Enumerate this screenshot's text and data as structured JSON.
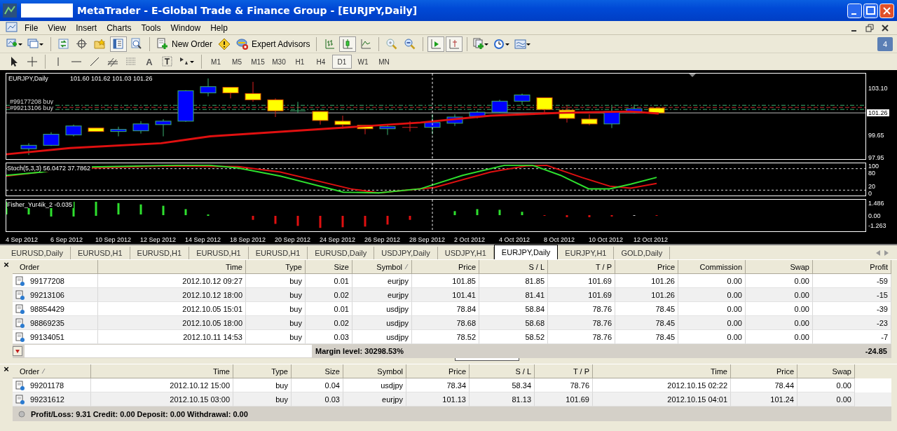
{
  "window": {
    "title": "MetaTrader - E-Global Trade & Finance Group - [EURJPY,Daily]"
  },
  "menu": [
    "File",
    "View",
    "Insert",
    "Charts",
    "Tools",
    "Window",
    "Help"
  ],
  "toolbar": {
    "data_window_on": true,
    "new_order": "New Order",
    "expert_advisors": "Expert Advisors",
    "chart_modes": [
      {
        "selected": false
      },
      {
        "selected": true
      },
      {
        "selected": false
      }
    ],
    "auto_scroll_on": true,
    "chart_shift_on": true,
    "notifications": "4"
  },
  "drawing_toolbar": {
    "text_tool": "A",
    "timeframes": [
      {
        "label": "M1",
        "selected": false
      },
      {
        "label": "M5",
        "selected": false
      },
      {
        "label": "M15",
        "selected": false
      },
      {
        "label": "M30",
        "selected": false
      },
      {
        "label": "H1",
        "selected": false
      },
      {
        "label": "H4",
        "selected": false
      },
      {
        "label": "D1",
        "selected": true
      },
      {
        "label": "W1",
        "selected": false
      },
      {
        "label": "MN",
        "selected": false
      }
    ]
  },
  "chart": {
    "symbol": "EURJPY,Daily",
    "ohlc": "101.60 101.62 101.03 101.26",
    "order_lines": [
      "#99177208 buy",
      "#99213106 buy"
    ],
    "price_axis": [
      "103.10",
      "99.65",
      "97.95"
    ],
    "current_price": "101.26",
    "stochastic": {
      "label": "Stoch(5,3,3) 56.0472 37.7862",
      "axis": [
        "100",
        "80",
        "20",
        "0"
      ]
    },
    "fisher": {
      "label": "Fisher_Yur4ik_2 -0.035",
      "axis": [
        "1.486",
        "0.00",
        "-1.263"
      ]
    },
    "dates": [
      "4 Sep 2012",
      "6 Sep 2012",
      "10 Sep 2012",
      "12 Sep 2012",
      "14 Sep 2012",
      "18 Sep 2012",
      "20 Sep 2012",
      "24 Sep 2012",
      "26 Sep 2012",
      "28 Sep 2012",
      "2 Oct 2012",
      "4 Oct 2012",
      "8 Oct 2012",
      "10 Oct 2012",
      "12 Oct 2012"
    ]
  },
  "chart_tabs": [
    {
      "label": "EURUSD,Daily",
      "selected": false
    },
    {
      "label": "EURUSD,H1",
      "selected": false
    },
    {
      "label": "EURUSD,H1",
      "selected": false
    },
    {
      "label": "EURUSD,H1",
      "selected": false
    },
    {
      "label": "EURUSD,H1",
      "selected": false
    },
    {
      "label": "EURUSD,Daily",
      "selected": false
    },
    {
      "label": "USDJPY,Daily",
      "selected": false
    },
    {
      "label": "USDJPY,H1",
      "selected": false
    },
    {
      "label": "EURJPY,Daily",
      "selected": true
    },
    {
      "label": "EURJPY,H1",
      "selected": false
    },
    {
      "label": "GOLD,Daily",
      "selected": false
    }
  ],
  "trade": {
    "close": "×",
    "columns": [
      {
        "label": "Order",
        "sorted": false
      },
      {
        "label": "Time",
        "sorted": false
      },
      {
        "label": "Type",
        "sorted": false
      },
      {
        "label": "Size",
        "sorted": false
      },
      {
        "label": "Symbol",
        "sorted": true
      },
      {
        "label": "Price",
        "sorted": false
      },
      {
        "label": "S / L",
        "sorted": false
      },
      {
        "label": "T / P",
        "sorted": false
      },
      {
        "label": "Price",
        "sorted": false
      },
      {
        "label": "Commission",
        "sorted": false
      },
      {
        "label": "Swap",
        "sorted": false
      },
      {
        "label": "Profit",
        "sorted": false
      }
    ],
    "rows": [
      [
        "99177208",
        "2012.10.12 09:27",
        "buy",
        "0.01",
        "eurjpy",
        "101.85",
        "81.85",
        "101.69",
        "101.26",
        "0.00",
        "0.00",
        "-59"
      ],
      [
        "99213106",
        "2012.10.12 18:00",
        "buy",
        "0.02",
        "eurjpy",
        "101.41",
        "81.41",
        "101.69",
        "101.26",
        "0.00",
        "0.00",
        "-15"
      ],
      [
        "98854429",
        "2012.10.05 15:01",
        "buy",
        "0.01",
        "usdjpy",
        "78.84",
        "58.84",
        "78.76",
        "78.45",
        "0.00",
        "0.00",
        "-39"
      ],
      [
        "98869235",
        "2012.10.05 18:00",
        "buy",
        "0.02",
        "usdjpy",
        "78.68",
        "58.68",
        "78.76",
        "78.45",
        "0.00",
        "0.00",
        "-23"
      ],
      [
        "99134051",
        "2012.10.11 14:53",
        "buy",
        "0.03",
        "usdjpy",
        "78.52",
        "58.52",
        "78.76",
        "78.45",
        "0.00",
        "0.00",
        "-7"
      ]
    ],
    "margin_level": "Margin level: 30298.53%",
    "total_profit": "-24.85"
  },
  "history": {
    "close": "×",
    "columns": [
      {
        "label": "Order",
        "sorted": true
      },
      {
        "label": "Time",
        "sorted": false
      },
      {
        "label": "Type",
        "sorted": false
      },
      {
        "label": "Size",
        "sorted": false
      },
      {
        "label": "Symbol",
        "sorted": false
      },
      {
        "label": "Price",
        "sorted": false
      },
      {
        "label": "S / L",
        "sorted": false
      },
      {
        "label": "T / P",
        "sorted": false
      },
      {
        "label": "Time",
        "sorted": false
      },
      {
        "label": "Price",
        "sorted": false
      },
      {
        "label": "Swap",
        "sorted": false
      }
    ],
    "rows": [
      [
        "99201178",
        "2012.10.12 15:00",
        "buy",
        "0.04",
        "usdjpy",
        "78.34",
        "58.34",
        "78.76",
        "2012.10.15 02:22",
        "78.44",
        "0.00"
      ],
      [
        "99231612",
        "2012.10.15 03:00",
        "buy",
        "0.03",
        "eurjpy",
        "101.13",
        "81.13",
        "101.69",
        "2012.10.15 04:01",
        "101.24",
        "0.00"
      ]
    ],
    "summary": "Profit/Loss: 9.31  Credit: 0.00  Deposit: 0.00  Withdrawal: 0.00"
  }
}
